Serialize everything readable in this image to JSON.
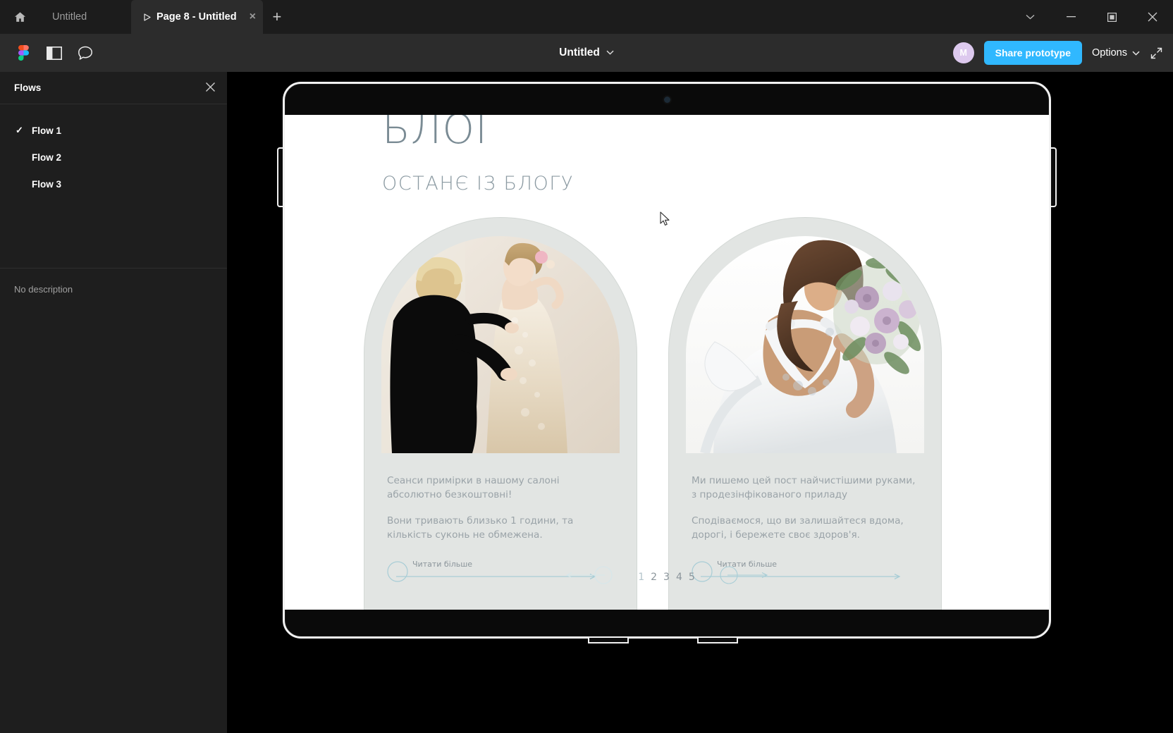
{
  "window": {
    "home_icon": "home-icon",
    "tabs": [
      {
        "label": "Untitled",
        "active": false,
        "has_play": false
      },
      {
        "label": "Page 8 - Untitled",
        "active": true,
        "has_play": true,
        "close": "×"
      }
    ],
    "new_tab": "+",
    "controls": {
      "more": "⌄",
      "minimize": "—",
      "maximize": "□",
      "close": "✕"
    }
  },
  "toolbar": {
    "figma_logo": "figma-logo-icon",
    "panel_toggle": "layers-panel-icon",
    "comment": "comment-icon",
    "doc_title": "Untitled",
    "doc_caret": "⌄",
    "avatar_initial": "M",
    "share_label": "Share prototype",
    "options_label": "Options",
    "options_caret": "⌄",
    "fullscreen_icon": "fullscreen-icon",
    "accent_color": "#30b8ff",
    "avatar_color": "#ddc9ee"
  },
  "sidebar": {
    "title": "Flows",
    "close": "✕",
    "flows": [
      {
        "label": "Flow 1",
        "selected": true,
        "check": "✓"
      },
      {
        "label": "Flow 2",
        "selected": false,
        "check": ""
      },
      {
        "label": "Flow 3",
        "selected": false,
        "check": ""
      }
    ],
    "description": "No description"
  },
  "prototype": {
    "page": {
      "heading": "БЛОГ",
      "subheading": "ОСТАНЄ ІЗ БЛОГУ",
      "cards": [
        {
          "photo_alt": "bride-fitting-photo",
          "paragraph_1": "Сеанси примірки в нашому салоні абсолютно безкоштовні!",
          "paragraph_2": "Вони тривають близько 1 години, та кількість суконь не обмежена.",
          "read_more": "Читати більше"
        },
        {
          "photo_alt": "bride-bouquet-photo",
          "paragraph_1": "Ми пишемо цей пост найчистішими руками, з продезінфікованого приладу",
          "paragraph_2": "Сподіваємося, що ви залишайтеся вдома, дорогі, і бережете своє здоров'я.",
          "read_more": "Читати більше"
        }
      ],
      "pagination": {
        "prev_icon": "prev-arrow-icon",
        "pages": [
          "1",
          "2",
          "3",
          "4",
          "5"
        ],
        "current": "1",
        "next_icon": "next-arrow-icon"
      },
      "text_color": "#9aa3a8",
      "heading_color": "#7a8b94",
      "card_bg": "#e2e5e3",
      "accent_line": "#a8cdd6"
    },
    "device": "tablet-frame"
  },
  "cursor": {
    "name": "mouse-pointer"
  }
}
